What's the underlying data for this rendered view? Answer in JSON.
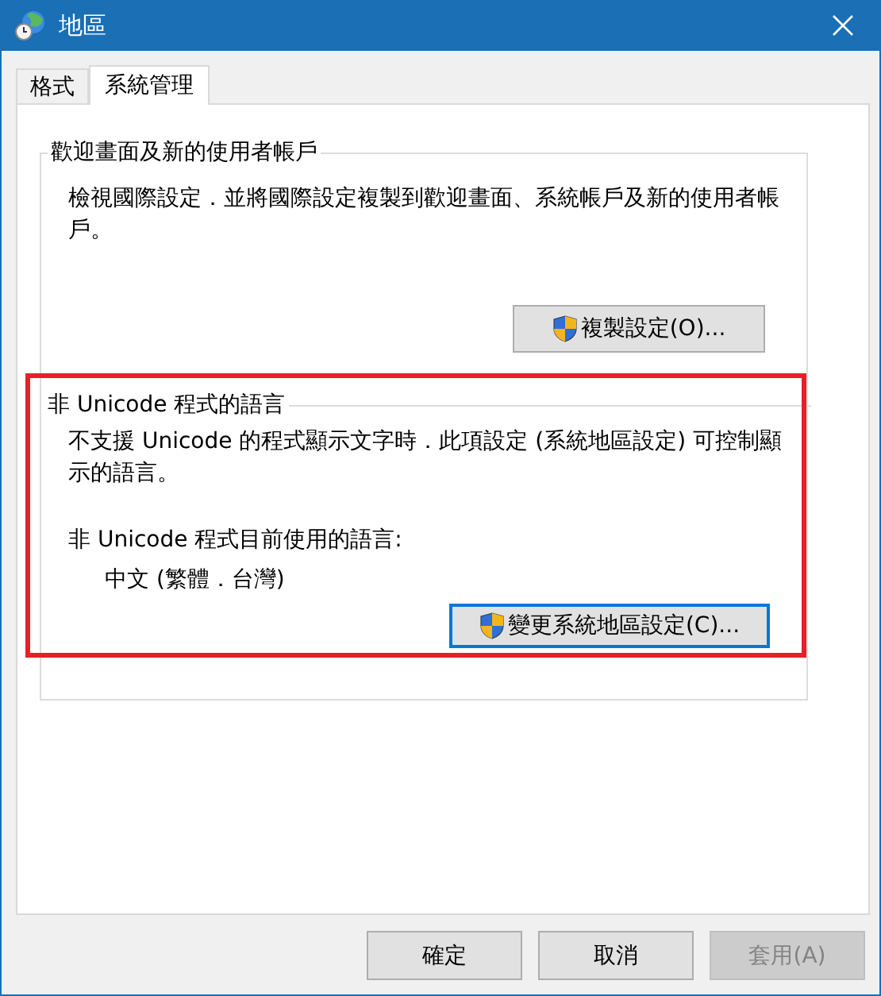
{
  "window": {
    "title": "地區"
  },
  "tabs": [
    {
      "label": "格式",
      "selected": false
    },
    {
      "label": "系統管理",
      "selected": true
    }
  ],
  "groups": [
    {
      "title": "歡迎畫面及新的使用者帳戶",
      "paragraphs": [
        {
          "kind": "text",
          "text": "檢視國際設定．並將國際設定複製到歡迎畫面、系統帳戶及新的使用者帳戶。"
        }
      ],
      "button": {
        "label": "複製設定(O)...",
        "kind": "shield",
        "focused": false,
        "disabled": false
      }
    },
    {
      "title": "非 Unicode 程式的語言",
      "highlighted": true,
      "paragraphs": [
        {
          "kind": "text",
          "text": "不支援 Unicode 的程式顯示文字時．此項設定 (系統地區設定) 可控制顯示的語言。"
        },
        {
          "kind": "label",
          "text": "非 Unicode 程式目前使用的語言:"
        },
        {
          "kind": "value",
          "text": "中文 (繁體．台灣)"
        }
      ],
      "button": {
        "label": "變更系統地區設定(C)...",
        "kind": "shield",
        "focused": true,
        "disabled": false
      }
    }
  ],
  "buttons": [
    {
      "label": "確定",
      "disabled": false
    },
    {
      "label": "取消",
      "disabled": false
    },
    {
      "label": "套用(A)",
      "disabled": true
    }
  ]
}
